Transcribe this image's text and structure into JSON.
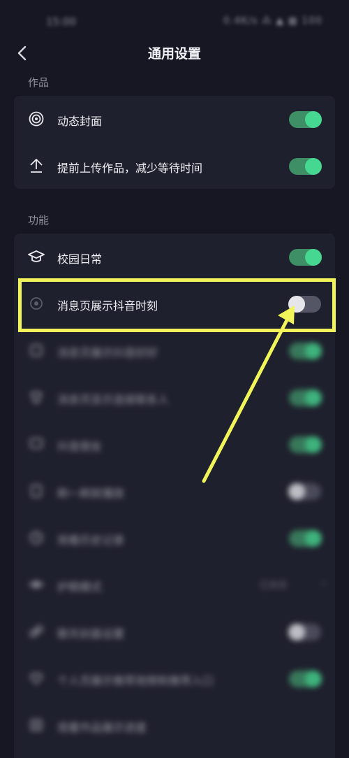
{
  "status_bar": {
    "time": "15:00",
    "icons": "0.4K/s ⁂ ▲ ▦ 100"
  },
  "nav": {
    "title": "通用设置"
  },
  "sections": {
    "works": {
      "label": "作品",
      "rows": [
        {
          "label": "动态封面",
          "icon": "concentric-circle-icon",
          "toggle": true
        },
        {
          "label": "提前上传作品，减少等待时间",
          "icon": "upload-arrow-icon",
          "toggle": true
        }
      ]
    },
    "features": {
      "label": "功能",
      "rows": [
        {
          "label": "校园日常",
          "icon": "graduation-cap-icon",
          "toggle": true
        },
        {
          "label": "消息页展示抖音时刻",
          "icon": "circle-dot-icon",
          "toggle": false
        },
        {
          "label": "消息页展示抖音好好",
          "icon": "edit-icon",
          "toggle": true
        },
        {
          "label": "消息页显示连接联系人",
          "icon": "shirt-icon",
          "toggle": true
        },
        {
          "label": "抖音朋友",
          "icon": "chat-icon",
          "toggle": true
        },
        {
          "label": "刷一刷就播放",
          "icon": "doc-icon",
          "toggle": false
        },
        {
          "label": "观看历史记录",
          "icon": "clock-icon",
          "toggle": true
        },
        {
          "label": "护眼模式",
          "icon": "eye-icon",
          "value": "已关闭"
        },
        {
          "label": "聊天封面设置",
          "icon": "link-icon",
          "toggle": false
        },
        {
          "label": "个人页展示推荐视频和推荐入口",
          "icon": "heart-icon",
          "toggle": true
        },
        {
          "label": "观看作品展示进度",
          "icon": "list-icon"
        }
      ]
    }
  },
  "colors": {
    "background": "#161722",
    "card": "#1f202d",
    "toggle_on": "#46d890",
    "highlight": "#f1f55a"
  }
}
